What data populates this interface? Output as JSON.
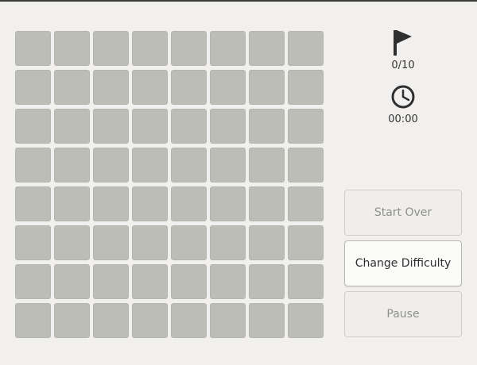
{
  "game": {
    "rows": 8,
    "cols": 8,
    "cell_state": "covered"
  },
  "status": {
    "flag_icon": "flag-icon",
    "flags": "0/10",
    "clock_icon": "clock-icon",
    "time": "00:00"
  },
  "buttons": {
    "start_over": "Start Over",
    "change_difficulty": "Change Difficulty",
    "pause": "Pause"
  },
  "colors": {
    "background": "#f1f0ee",
    "cell": "#bcbdb7",
    "text": "#2f2f2f",
    "disabled_text": "#8f8f8d"
  }
}
